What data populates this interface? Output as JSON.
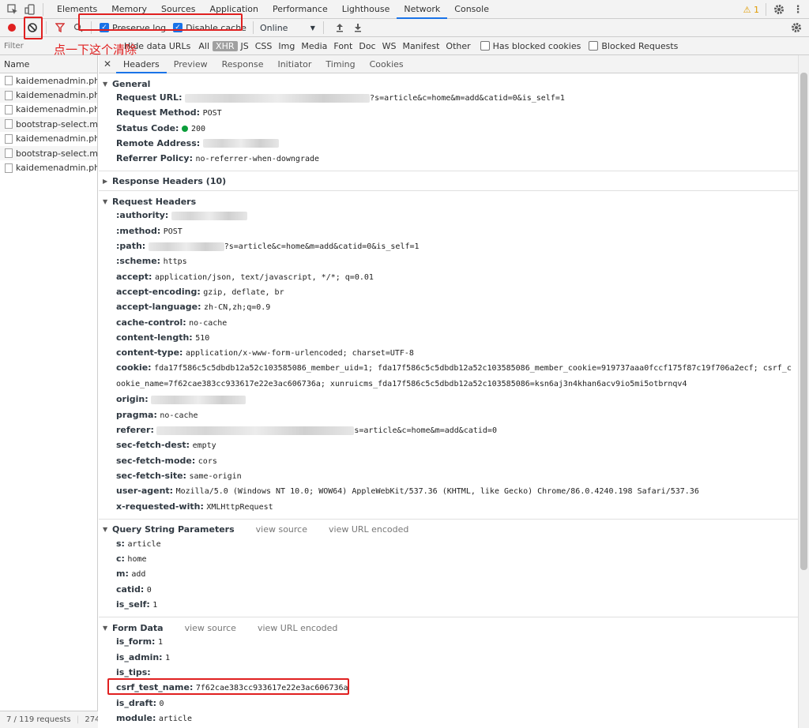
{
  "tabs": [
    "Elements",
    "Memory",
    "Sources",
    "Application",
    "Performance",
    "Lighthouse",
    "Network",
    "Console"
  ],
  "active_tab": "Network",
  "warning_count": "1",
  "toolbar": {
    "preserve_log": "Preserve log",
    "disable_cache": "Disable cache",
    "throttle": "Online"
  },
  "filter": {
    "placeholder": "Filter",
    "hide_data_urls": "Hide data URLs",
    "types": [
      "All",
      "XHR",
      "JS",
      "CSS",
      "Img",
      "Media",
      "Font",
      "Doc",
      "WS",
      "Manifest",
      "Other"
    ],
    "active_type": "XHR",
    "blocked_cookies": "Has blocked cookies",
    "blocked_requests": "Blocked Requests"
  },
  "annotation_text": "点一下这个清除",
  "list": {
    "header": "Name",
    "items": [
      "kaidemenadmin.ph...",
      "kaidemenadmin.ph...",
      "kaidemenadmin.ph...",
      "bootstrap-select.mi...",
      "kaidemenadmin.ph...",
      "bootstrap-select.mi...",
      "kaidemenadmin.ph..."
    ],
    "footer": "7 / 119 requests",
    "footer_size": "274"
  },
  "subtabs": [
    "Headers",
    "Preview",
    "Response",
    "Initiator",
    "Timing",
    "Cookies"
  ],
  "active_subtab": "Headers",
  "general": {
    "title": "General",
    "request_url_key": "Request URL:",
    "request_url_val": "?s=article&c=home&m=add&catid=0&is_self=1",
    "method_key": "Request Method:",
    "method_val": "POST",
    "status_key": "Status Code:",
    "status_val": "200",
    "remote_key": "Remote Address:",
    "referrer_key": "Referrer Policy:",
    "referrer_val": "no-referrer-when-downgrade"
  },
  "response_headers_title": "Response Headers (10)",
  "request_headers": {
    "title": "Request Headers",
    "authority": ":authority:",
    "method_k": ":method:",
    "method_v": "POST",
    "path_k": ":path:",
    "path_v": "?s=article&c=home&m=add&catid=0&is_self=1",
    "scheme_k": ":scheme:",
    "scheme_v": "https",
    "accept_k": "accept:",
    "accept_v": "application/json, text/javascript, */*; q=0.01",
    "enc_k": "accept-encoding:",
    "enc_v": "gzip, deflate, br",
    "lang_k": "accept-language:",
    "lang_v": "zh-CN,zh;q=0.9",
    "cache_k": "cache-control:",
    "cache_v": "no-cache",
    "len_k": "content-length:",
    "len_v": "510",
    "ctype_k": "content-type:",
    "ctype_v": "application/x-www-form-urlencoded; charset=UTF-8",
    "cookie_k": "cookie:",
    "cookie_v": "fda17f586c5c5dbdb12a52c103585086_member_uid=1; fda17f586c5c5dbdb12a52c103585086_member_cookie=919737aaa0fccf175f87c19f706a2ecf; csrf_cookie_name=7f62cae383cc933617e22e3ac606736a; xunruicms_fda17f586c5c5dbdb12a52c103585086=ksn6aj3n4khan6acv9io5mi5otbrnqv4",
    "origin_k": "origin:",
    "pragma_k": "pragma:",
    "pragma_v": "no-cache",
    "referer_k": "referer:",
    "referer_v": "s=article&c=home&m=add&catid=0",
    "dest_k": "sec-fetch-dest:",
    "dest_v": "empty",
    "mode_k": "sec-fetch-mode:",
    "mode_v": "cors",
    "site_k": "sec-fetch-site:",
    "site_v": "same-origin",
    "ua_k": "user-agent:",
    "ua_v": "Mozilla/5.0 (Windows NT 10.0; WOW64) AppleWebKit/537.36 (KHTML, like Gecko) Chrome/86.0.4240.198 Safari/537.36",
    "xrw_k": "x-requested-with:",
    "xrw_v": "XMLHttpRequest"
  },
  "query": {
    "title": "Query String Parameters",
    "view_source": "view source",
    "view_url_encoded": "view URL encoded",
    "s_k": "s:",
    "s_v": "article",
    "c_k": "c:",
    "c_v": "home",
    "m_k": "m:",
    "m_v": "add",
    "catid_k": "catid:",
    "catid_v": "0",
    "self_k": "is_self:",
    "self_v": "1"
  },
  "form": {
    "title": "Form Data",
    "view_source": "view source",
    "view_url_encoded": "view URL encoded",
    "is_form_k": "is_form:",
    "is_form_v": "1",
    "is_admin_k": "is_admin:",
    "is_admin_v": "1",
    "is_tips_k": "is_tips:",
    "is_tips_v": "",
    "csrf_k": "csrf_test_name:",
    "csrf_v": "7f62cae383cc933617e22e3ac606736a",
    "draft_k": "is_draft:",
    "draft_v": "0",
    "module_k": "module:",
    "module_v": "article"
  },
  "colors": {
    "accent": "#1a73e8",
    "record": "#e02020",
    "annotation": "#e02020",
    "status_ok": "#0a9d3a"
  }
}
